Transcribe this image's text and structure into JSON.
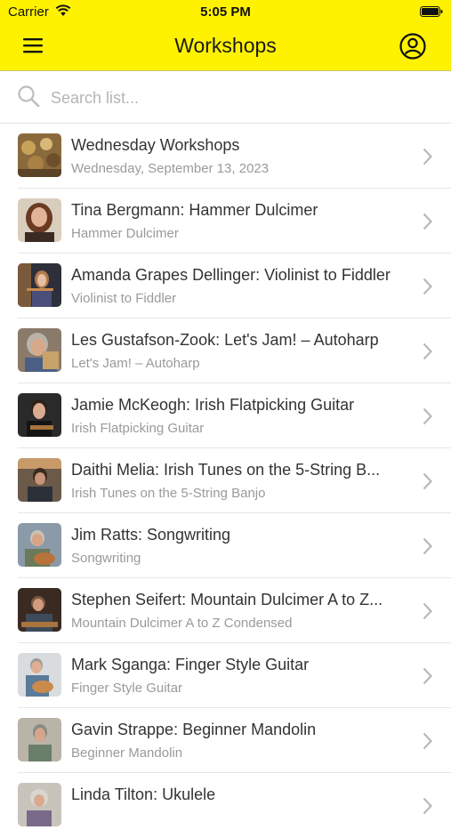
{
  "status_bar": {
    "carrier": "Carrier",
    "time": "5:05 PM"
  },
  "nav": {
    "title": "Workshops"
  },
  "search": {
    "placeholder": "Search list..."
  },
  "colors": {
    "header_bg": "#fff200",
    "text_primary": "#333333",
    "text_secondary": "#9a9a9a"
  },
  "workshops": [
    {
      "title": "Wednesday Workshops",
      "subtitle": "Wednesday, September 13, 2023"
    },
    {
      "title": "Tina Bergmann: Hammer Dulcimer",
      "subtitle": "Hammer Dulcimer"
    },
    {
      "title": "Amanda Grapes Dellinger: Violinist to Fiddler",
      "subtitle": "Violinist to Fiddler"
    },
    {
      "title": "Les Gustafson-Zook:  Let's Jam! – Autoharp",
      "subtitle": "Let's Jam! – Autoharp"
    },
    {
      "title": "Jamie McKeogh:  Irish Flatpicking Guitar",
      "subtitle": "Irish Flatpicking Guitar"
    },
    {
      "title": "Daithi Melia:  Irish Tunes on the 5-String B...",
      "subtitle": "Irish Tunes on the 5-String Banjo"
    },
    {
      "title": "Jim Ratts: Songwriting",
      "subtitle": "Songwriting"
    },
    {
      "title": "Stephen Seifert:  Mountain Dulcimer A to Z...",
      "subtitle": "Mountain Dulcimer A to Z Condensed"
    },
    {
      "title": "Mark Sganga: Finger Style Guitar",
      "subtitle": "Finger Style Guitar"
    },
    {
      "title": "Gavin Strappe:  Beginner Mandolin",
      "subtitle": "Beginner Mandolin"
    },
    {
      "title": "Linda Tilton: Ukulele",
      "subtitle": ""
    }
  ]
}
